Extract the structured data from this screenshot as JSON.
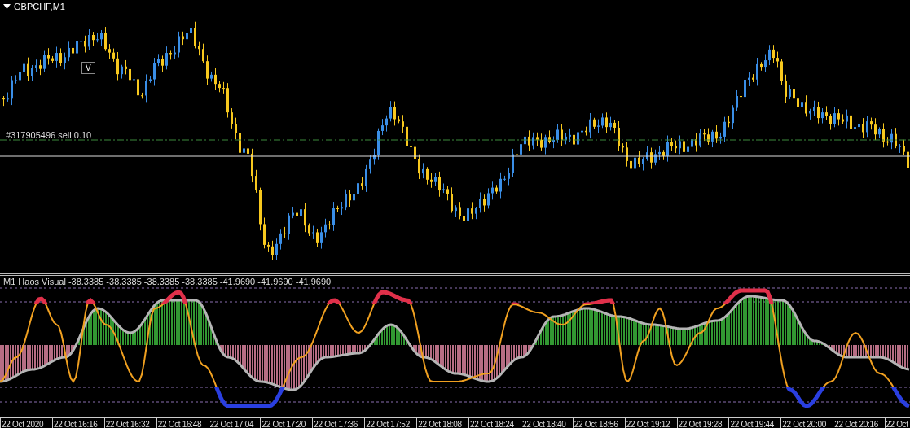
{
  "chart": {
    "title": "GBPCHF,M1",
    "marker": "V",
    "order_label": "#317905496 sell 0.10"
  },
  "indicator": {
    "title": "M1 Haos Visual -38.3385 -38.3385 -38.3385 -38.3385 -41.9690 -41.9690 -41.9690"
  },
  "time_axis": {
    "labels": [
      "22 Oct 2020",
      "22 Oct 16:16",
      "22 Oct 16:32",
      "22 Oct 16:48",
      "22 Oct 17:04",
      "22 Oct 17:20",
      "22 Oct 17:36",
      "22 Oct 17:52",
      "22 Oct 18:08",
      "22 Oct 18:24",
      "22 Oct 18:40",
      "22 Oct 18:56",
      "22 Oct 19:12",
      "22 Oct 19:28",
      "22 Oct 19:44",
      "22 Oct 20:00",
      "22 Oct 20:16",
      "22 Oct"
    ]
  }
}
